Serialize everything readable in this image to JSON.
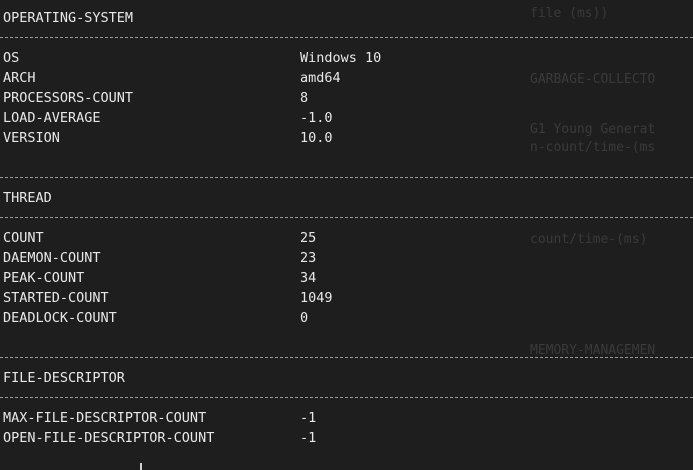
{
  "sections": [
    {
      "title": "OPERATING-SYSTEM",
      "rows": [
        {
          "key": "OS",
          "value": "Windows 10"
        },
        {
          "key": "ARCH",
          "value": "amd64"
        },
        {
          "key": "PROCESSORS-COUNT",
          "value": "8"
        },
        {
          "key": "LOAD-AVERAGE",
          "value": "-1.0"
        },
        {
          "key": "VERSION",
          "value": "10.0"
        }
      ]
    },
    {
      "title": "THREAD",
      "rows": [
        {
          "key": "COUNT",
          "value": "25"
        },
        {
          "key": "DAEMON-COUNT",
          "value": "23"
        },
        {
          "key": "PEAK-COUNT",
          "value": "34"
        },
        {
          "key": "STARTED-COUNT",
          "value": "1049"
        },
        {
          "key": "DEADLOCK-COUNT",
          "value": "0"
        }
      ]
    },
    {
      "title": "FILE-DESCRIPTOR",
      "rows": [
        {
          "key": "MAX-FILE-DESCRIPTOR-COUNT",
          "value": "-1"
        },
        {
          "key": "OPEN-FILE-DESCRIPTOR-COUNT",
          "value": "-1"
        }
      ]
    }
  ],
  "background": {
    "ghost_1": "file (ms))",
    "ghost_2": "GARBAGE-COLLECTO",
    "ghost_3": "G1 Young Generat",
    "ghost_4": "n-count/time-(ms",
    "ghost_5": "count/time-(ms)",
    "ghost_6": "MEMORY-MANAGEMEN"
  },
  "colors": {
    "background": "#1e1e1e",
    "text": "#e8e8e8",
    "separator": "#9a9a9a"
  }
}
